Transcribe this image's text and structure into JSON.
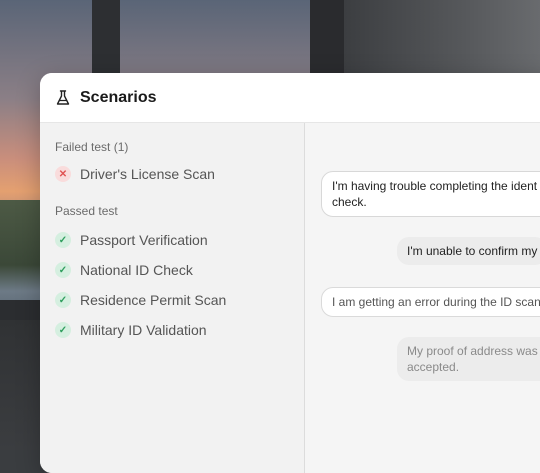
{
  "header": {
    "title": "Scenarios",
    "icon": "flask-icon"
  },
  "sidebar": {
    "failed_label": "Failed test (1)",
    "failed_items": [
      {
        "label": "Driver's License Scan",
        "status": "fail"
      }
    ],
    "passed_label": "Passed test",
    "passed_items": [
      {
        "label": "Passport Verification",
        "status": "pass"
      },
      {
        "label": "National ID Check",
        "status": "pass"
      },
      {
        "label": "Residence Permit Scan",
        "status": "pass"
      },
      {
        "label": "Military ID Validation",
        "status": "pass"
      }
    ]
  },
  "chat": {
    "messages": [
      {
        "text": "I'm having trouble completing the ident check."
      },
      {
        "text": "I'm unable to confirm my"
      },
      {
        "text": "I am getting an error during the ID scan"
      },
      {
        "text": "My proof of address was accepted."
      }
    ]
  },
  "colors": {
    "fail": "#e05353",
    "pass": "#2f9e5e"
  }
}
